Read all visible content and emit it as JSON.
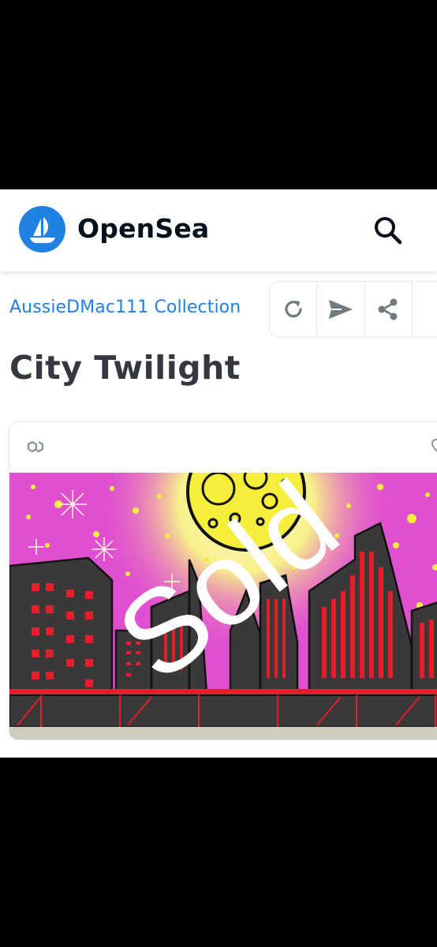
{
  "header": {
    "brand": "OpenSea",
    "logo_icon": "opensea-sailboat-icon",
    "search_icon": "search-icon"
  },
  "collection": {
    "link_label": "AussieDMac111 Collection"
  },
  "actions": [
    {
      "icon": "refresh-icon"
    },
    {
      "icon": "send-icon"
    },
    {
      "icon": "share-icon"
    }
  ],
  "item": {
    "title": "City Twilight",
    "chain_icon": "polygon-chain-icon",
    "overlay_text": "Sold"
  },
  "colors": {
    "accent": "#2081e2",
    "title": "#353840",
    "sky": "#e04fd0",
    "moon": "#f5ee3a",
    "building": "#3a3838",
    "window": "#e0202a"
  }
}
